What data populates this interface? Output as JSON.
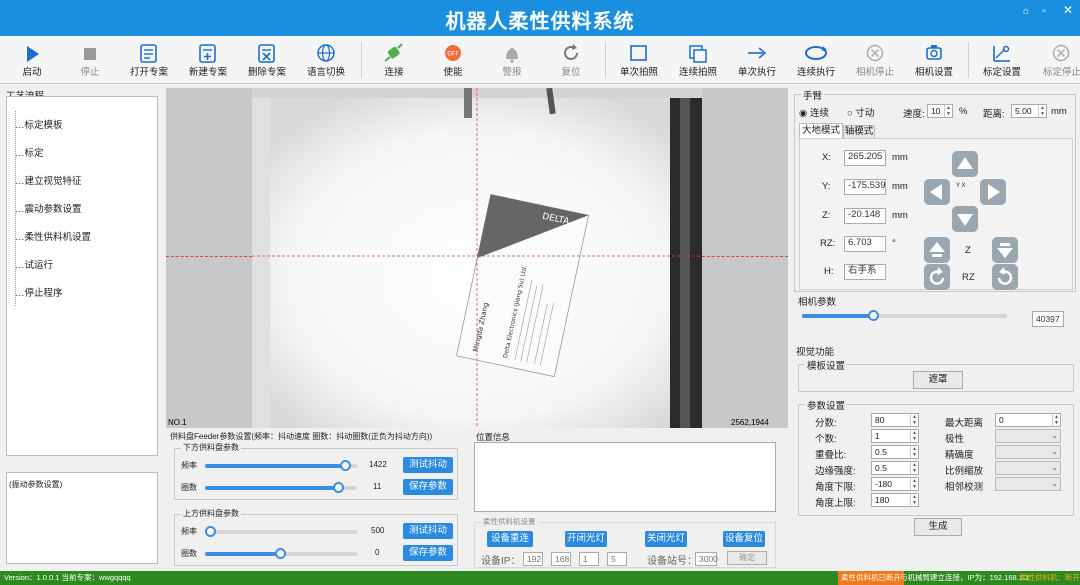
{
  "app": {
    "title": "机器人柔性供料系统"
  },
  "window_controls": [
    "⌂",
    "▫",
    "—",
    "✕"
  ],
  "toolbar": [
    {
      "label": "启动",
      "icon": "play-icon",
      "enabled": true
    },
    {
      "label": "停止",
      "icon": "stop-icon",
      "enabled": false
    },
    {
      "label": "打开专案",
      "icon": "open-project-icon",
      "enabled": true
    },
    {
      "label": "新建专案",
      "icon": "new-project-icon",
      "enabled": true
    },
    {
      "label": "删除专案",
      "icon": "delete-project-icon",
      "enabled": true
    },
    {
      "label": "语言切换",
      "icon": "globe-icon",
      "enabled": true
    },
    {
      "label": "连接",
      "icon": "connect-plug-icon",
      "enabled": true
    },
    {
      "label": "使能",
      "icon": "enable-icon",
      "enabled": true
    },
    {
      "label": "警报",
      "icon": "alarm-bell-icon",
      "enabled": false
    },
    {
      "label": "复位",
      "icon": "reset-icon",
      "enabled": false
    },
    {
      "label": "单次拍照",
      "icon": "single-capture-icon",
      "enabled": true
    },
    {
      "label": "连续拍照",
      "icon": "continuous-capture-icon",
      "enabled": true
    },
    {
      "label": "单次执行",
      "icon": "single-run-icon",
      "enabled": true
    },
    {
      "label": "连续执行",
      "icon": "continuous-run-icon",
      "enabled": true
    },
    {
      "label": "相机停止",
      "icon": "camera-stop-icon",
      "enabled": false
    },
    {
      "label": "相机设置",
      "icon": "camera-settings-icon",
      "enabled": true
    },
    {
      "label": "标定设置",
      "icon": "calibration-settings-icon",
      "enabled": true
    },
    {
      "label": "标定停止",
      "icon": "calibration-stop-icon",
      "enabled": false
    }
  ],
  "flow": {
    "title": "工艺流程",
    "items": [
      "标定模板",
      "标定",
      "建立视觉特征",
      "震动参数设置",
      "柔性供料机设置",
      "试运行",
      "停止程序"
    ]
  },
  "debug": {
    "title": "(振动参数设置)"
  },
  "view": {
    "corner_label": "NO.1",
    "coord_label": "2562,1944",
    "card_lines": [
      "Mingda Zhang",
      "Delta Electronics (Jiang Su) Ltd.",
      "DELTA"
    ]
  },
  "feeder": {
    "title": "供料盘Feeder参数设置(频率：抖动速度 圈数：抖动圈数(正负为抖动方向))",
    "lower": {
      "title": "下方供料盘参数",
      "freq_label": "频率",
      "freq_value": "1422",
      "freq_fraction": 0.93,
      "turns_label": "圈数",
      "turns_value": "11",
      "turns_fraction": 0.88,
      "test_button": "测试抖动",
      "save_button": "保存参数"
    },
    "upper": {
      "title": "上方供料盘参数",
      "freq_label": "频率",
      "freq_value": "500",
      "freq_fraction": 0.0,
      "turns_label": "圈数",
      "turns_value": "0",
      "turns_fraction": 0.5,
      "test_button": "测试抖动",
      "save_button": "保存参数"
    }
  },
  "position": {
    "title": "位置信息"
  },
  "flex_feeder": {
    "title": "柔性供料机设置",
    "buttons": [
      "设备重连",
      "开闭光灯",
      "关闭光灯",
      "设备复位"
    ],
    "ip_label": "设备IP：",
    "ip": [
      "192",
      "168",
      "1",
      "5"
    ],
    "station_label": "设备站号：",
    "station": "3000",
    "confirm_button": "确定"
  },
  "hand": {
    "title": "手臂",
    "mode_continuous": "连续",
    "mode_jog": "寸动",
    "speed_label": "速度:",
    "speed_value": "10",
    "speed_unit": "%",
    "distance_label": "距离:",
    "distance_value": "5.00",
    "distance_unit": "mm",
    "tabs": [
      "大地模式",
      "轴模式"
    ],
    "fields": [
      {
        "label": "X:",
        "value": "265.205",
        "unit": "mm"
      },
      {
        "label": "Y:",
        "value": "-175.539",
        "unit": "mm"
      },
      {
        "label": "Z:",
        "value": "-20.148",
        "unit": "mm"
      },
      {
        "label": "RZ:",
        "value": "6.703",
        "unit": "°"
      },
      {
        "label": "H:",
        "value": "右手系",
        "unit": ""
      }
    ],
    "z_label": "Z",
    "rz_label": "RZ",
    "axis_glyph": "Y X"
  },
  "camera": {
    "title": "相机参数",
    "exposure": "40397",
    "exposure_fraction": 0.35
  },
  "vision": {
    "title": "视觉功能",
    "template_title": "模板设置",
    "mask_button": "遮罩",
    "params_title": "参数设置",
    "left_params": [
      {
        "label": "分数:",
        "value": "80"
      },
      {
        "label": "个数:",
        "value": "1"
      },
      {
        "label": "重叠比:",
        "value": "0.5"
      },
      {
        "label": "边缘强度:",
        "value": "0.5"
      },
      {
        "label": "角度下限:",
        "value": "-180"
      },
      {
        "label": "角度上限:",
        "value": "180"
      }
    ],
    "right_params": [
      {
        "label": "最大距离",
        "value": "0"
      },
      {
        "label": "极性",
        "value": ""
      },
      {
        "label": "精确度",
        "value": ""
      },
      {
        "label": "比例缩放",
        "value": ""
      },
      {
        "label": "相邻校测",
        "value": ""
      }
    ],
    "generate_button": "生成"
  },
  "status": {
    "version": "Version：1.0.0.1  当前专案：wwgqqqq",
    "alert": "柔性供料机已断开",
    "connection": "与机械臂建立连接，IP为：192.168.1.1",
    "extra": "柔性供料机：断开"
  }
}
